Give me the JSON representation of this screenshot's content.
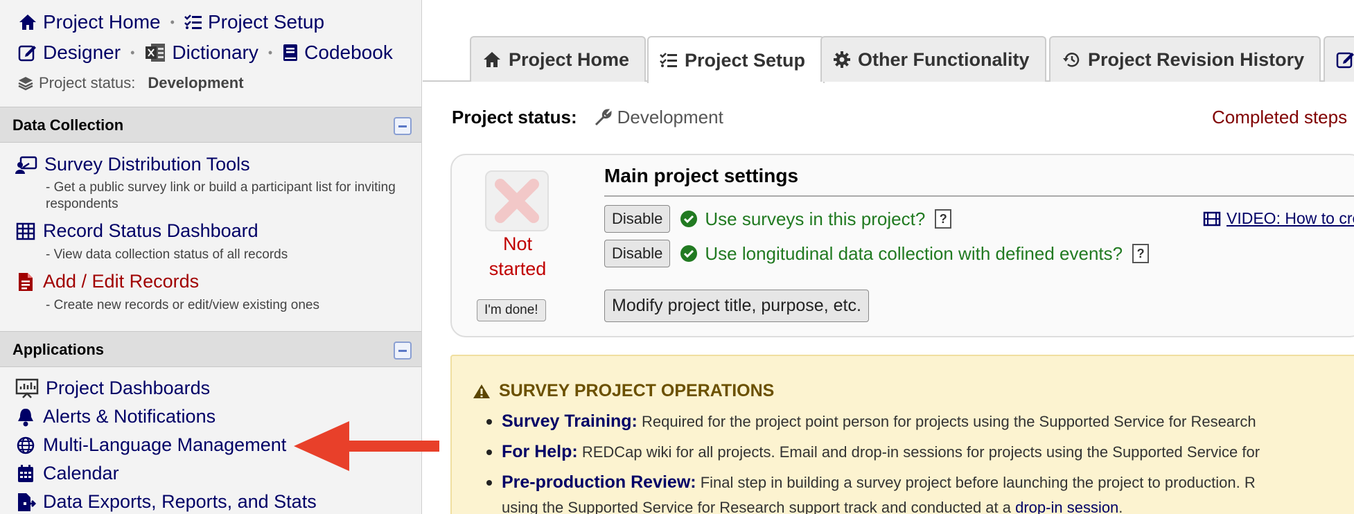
{
  "sidebar": {
    "nav": {
      "project_home": "Project Home",
      "project_setup": "Project Setup",
      "designer": "Designer",
      "dictionary": "Dictionary",
      "codebook": "Codebook",
      "status_label": "Project status:",
      "status_value": "Development"
    },
    "data_collection": {
      "title": "Data Collection",
      "items": [
        {
          "label": "Survey Distribution Tools",
          "desc": "- Get a public survey link or build a participant list for inviting respondents",
          "icon": "survey-distribution-icon"
        },
        {
          "label": "Record Status Dashboard",
          "desc": "- View data collection status of all records",
          "icon": "grid-table-icon"
        },
        {
          "label": "Add / Edit Records",
          "desc": "- Create new records or edit/view existing ones",
          "icon": "file-text-icon"
        }
      ]
    },
    "applications": {
      "title": "Applications",
      "items": [
        {
          "label": "Project Dashboards",
          "icon": "dashboard-icon"
        },
        {
          "label": "Alerts & Notifications",
          "icon": "bell-icon"
        },
        {
          "label": "Multi-Language Management",
          "icon": "globe-icon"
        },
        {
          "label": "Calendar",
          "icon": "calendar-icon"
        },
        {
          "label": "Data Exports, Reports, and Stats",
          "icon": "file-export-icon"
        }
      ]
    }
  },
  "tabs": [
    {
      "label": "Project Home",
      "icon": "home-icon"
    },
    {
      "label": "Project Setup",
      "icon": "checklist-icon",
      "active": true
    },
    {
      "label": "Other Functionality",
      "icon": "gear-icon"
    },
    {
      "label": "Project Revision History",
      "icon": "history-icon"
    }
  ],
  "main": {
    "status_label": "Project status:",
    "status_value": "Development",
    "completed_steps": "Completed steps",
    "settings": {
      "title": "Main project settings",
      "not_started": "Not started",
      "done_button": "I'm done!",
      "disable_label": "Disable",
      "option1": "Use surveys in this project?",
      "option2": "Use longitudinal data collection with defined events?",
      "qmark": "?",
      "video_link": "VIDEO: How to create",
      "modify_button": "Modify project title, purpose, etc."
    },
    "ops": {
      "title": "SURVEY PROJECT OPERATIONS",
      "items": [
        {
          "bold": "Survey Training:",
          "text": " Required for the project point person for projects using the Supported Service for Research"
        },
        {
          "bold": "For Help:",
          "text": " REDCap wiki for all projects. Email and drop-in sessions for projects using the Supported Service for"
        },
        {
          "bold": "Pre-production Review:",
          "text": " Final step in building a survey project before launching the project to production. R"
        }
      ],
      "continuation": "using the Supported Service for Research support track and conducted at a ",
      "continuation_link": "drop-in session",
      "continuation_end": "."
    }
  },
  "colors": {
    "link": "#000066",
    "red_item": "#a00000",
    "green_option": "#217a21",
    "arrow": "#e8402a",
    "ops_bg": "#fcf3d0"
  }
}
